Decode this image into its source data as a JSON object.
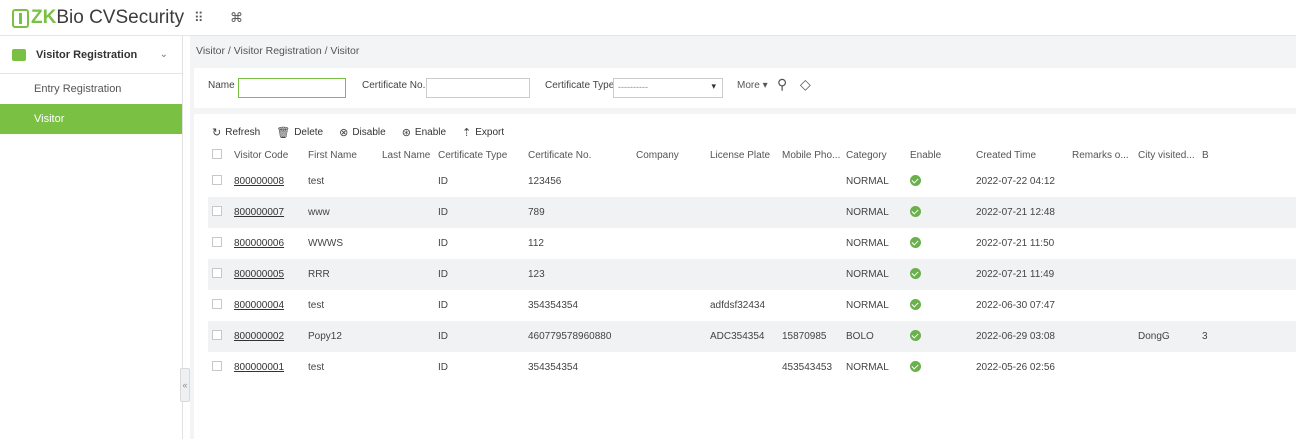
{
  "app": {
    "logo_prefix": "ZK",
    "logo_rest": "Bio CVSecurity"
  },
  "topbar": {
    "grid_icon": "⠿",
    "command_icon": "⌘"
  },
  "sidebar": {
    "section_label": "Visitor Registration",
    "items": [
      {
        "label": "Entry Registration"
      },
      {
        "label": "Visitor"
      }
    ],
    "collapse_glyph": "«"
  },
  "breadcrumb": "Visitor / Visitor Registration / Visitor",
  "search": {
    "name_label": "Name",
    "name_value": "",
    "cert_no_label": "Certificate No.",
    "cert_no_value": "",
    "cert_type_label": "Certificate Type",
    "cert_type_value": "----------",
    "more_label": "More",
    "more_caret": "▾",
    "select_caret": "▾",
    "search_icon_glyph": "⚲",
    "clear_icon_glyph": "◇"
  },
  "toolbar": {
    "refresh": "Refresh",
    "delete": "Delete",
    "disable": "Disable",
    "enable": "Enable",
    "export": "Export",
    "refresh_glyph": "↻",
    "delete_glyph": "🗑",
    "disable_glyph": "⊗",
    "enable_glyph": "⊛",
    "export_glyph": "⇡"
  },
  "columns": [
    "Visitor Code",
    "First Name",
    "Last Name",
    "Certificate Type",
    "Certificate No.",
    "Company",
    "License Plate",
    "Mobile Pho...",
    "Category",
    "Enable",
    "Created Time",
    "Remarks o...",
    "City visited...",
    "B"
  ],
  "rows": [
    [
      "800000008",
      "test",
      "",
      "ID",
      "123456",
      "",
      "",
      "",
      "NORMAL",
      "true",
      "2022-07-22 04:12",
      "",
      "",
      ""
    ],
    [
      "800000007",
      "www",
      "",
      "ID",
      "789",
      "",
      "",
      "",
      "NORMAL",
      "true",
      "2022-07-21 12:48",
      "",
      "",
      ""
    ],
    [
      "800000006",
      "WWWS",
      "",
      "ID",
      "112",
      "",
      "",
      "",
      "NORMAL",
      "true",
      "2022-07-21 11:50",
      "",
      "",
      ""
    ],
    [
      "800000005",
      "RRR",
      "",
      "ID",
      "123",
      "",
      "",
      "",
      "NORMAL",
      "true",
      "2022-07-21 11:49",
      "",
      "",
      ""
    ],
    [
      "800000004",
      "test",
      "",
      "ID",
      "354354354",
      "",
      "adfdsf32434",
      "",
      "NORMAL",
      "true",
      "2022-06-30 07:47",
      "",
      "",
      ""
    ],
    [
      "800000002",
      "Popy12",
      "",
      "ID",
      "460779578960880",
      "",
      "ADC354354",
      "15870985",
      "BOLO",
      "true",
      "2022-06-29 03:08",
      "",
      "DongG",
      "3"
    ],
    [
      "800000001",
      "test",
      "",
      "ID",
      "354354354",
      "",
      "",
      "453543453",
      "NORMAL",
      "true",
      "2022-05-26 02:56",
      "",
      "",
      ""
    ]
  ],
  "colors": {
    "accent": "#7ac143",
    "enable": "#6ab04c"
  }
}
